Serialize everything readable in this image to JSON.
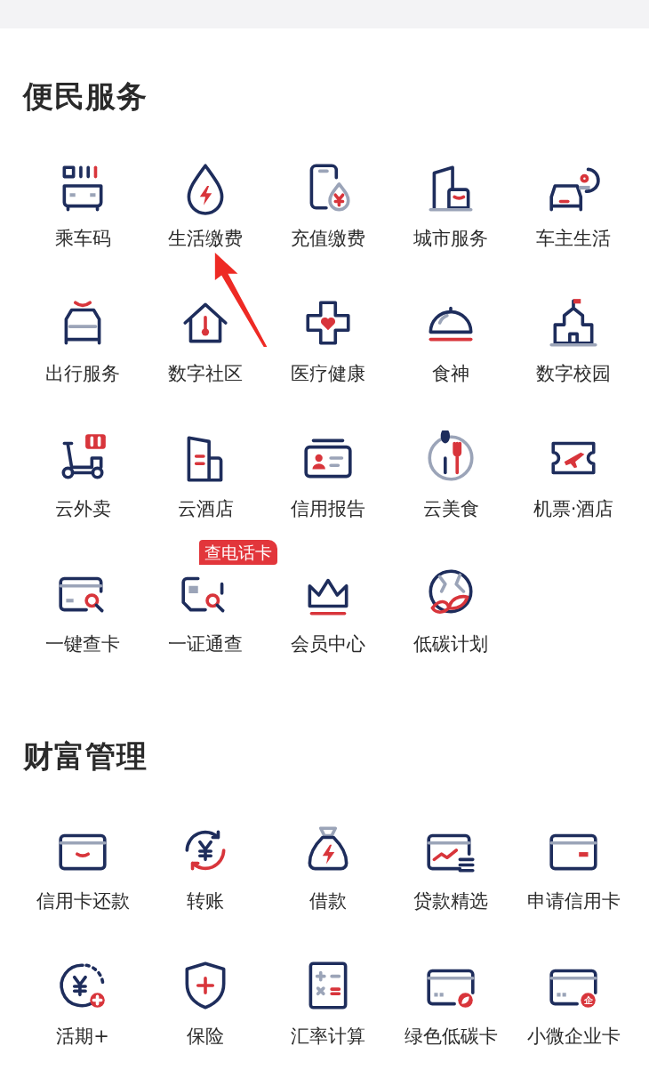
{
  "sections": [
    {
      "title": "便民服务",
      "items": [
        {
          "label": "乘车码"
        },
        {
          "label": "生活缴费"
        },
        {
          "label": "充值缴费"
        },
        {
          "label": "城市服务"
        },
        {
          "label": "车主生活"
        },
        {
          "label": "出行服务"
        },
        {
          "label": "数字社区"
        },
        {
          "label": "医疗健康"
        },
        {
          "label": "食神"
        },
        {
          "label": "数字校园"
        },
        {
          "label": "云外卖"
        },
        {
          "label": "云酒店"
        },
        {
          "label": "信用报告"
        },
        {
          "label": "云美食"
        },
        {
          "label": "机票·酒店"
        },
        {
          "label": "一键查卡"
        },
        {
          "label": "一证通查",
          "tag": "查电话卡"
        },
        {
          "label": "会员中心"
        },
        {
          "label": "低碳计划"
        }
      ]
    },
    {
      "title": "财富管理",
      "items": [
        {
          "label": "信用卡还款"
        },
        {
          "label": "转账"
        },
        {
          "label": "借款"
        },
        {
          "label": "贷款精选"
        },
        {
          "label": "申请信用卡"
        },
        {
          "label": "活期+"
        },
        {
          "label": "保险"
        },
        {
          "label": "汇率计算"
        },
        {
          "label": "绿色低碳卡"
        },
        {
          "label": "小微企业卡",
          "icon_mark": "企"
        }
      ]
    }
  ]
}
